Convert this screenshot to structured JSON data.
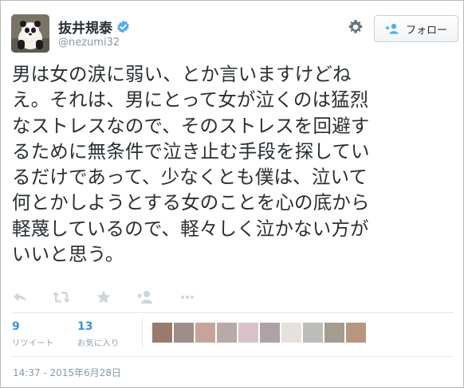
{
  "header": {
    "display_name": "抜井規泰",
    "handle": "@nezumi32",
    "follow_label": "フォロー"
  },
  "tweet": {
    "lines": [
      "男は女の涙に弱い、とか言いますけどね",
      "え。それは、男にとって女が泣くのは猛烈",
      "なストレスなので、そのストレスを回避す",
      "るために無条件で泣き止む手段を探してい",
      "るだけであって、少なくとも僕は、泣いて",
      "何とかしようとする女のことを心の底から",
      "軽蔑しているので、軽々しく泣かない方が",
      "いいと思う。"
    ]
  },
  "actions": [
    "reply-icon",
    "retweet-icon",
    "favorite-icon",
    "follow-icon",
    "more-icon"
  ],
  "stats": {
    "retweets": {
      "count": "9",
      "label": "リツイート"
    },
    "favorites": {
      "count": "13",
      "label": "お気に入り"
    }
  },
  "favoriter_avatar_colors": [
    "#9a7b6b",
    "#a08c89",
    "#c7a49a",
    "#b8aaa6",
    "#d8c2c8",
    "#aea2a6",
    "#e6e1dd",
    "#bcbcb8",
    "#a49c8e",
    "#b8957e"
  ],
  "timestamp": "14:37 - 2015年6月28日",
  "colors": {
    "link_blue": "#3b94d9",
    "verified_blue": "#55acee",
    "muted": "#8899a6"
  }
}
